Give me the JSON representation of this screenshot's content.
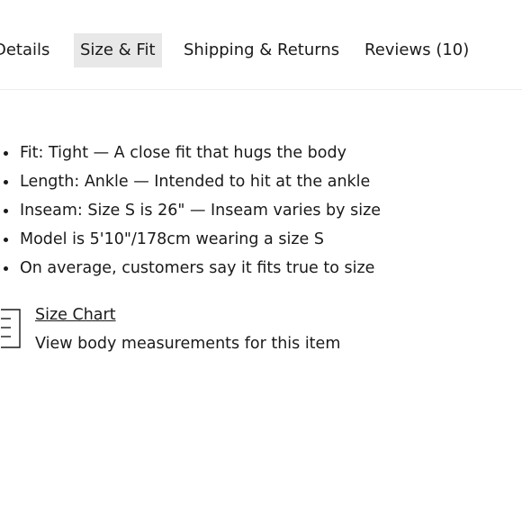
{
  "tabs": [
    {
      "label": "Details",
      "active": false
    },
    {
      "label": "Size & Fit",
      "active": true
    },
    {
      "label": "Shipping & Returns",
      "active": false
    },
    {
      "label": "Reviews (10)",
      "active": false
    }
  ],
  "fit_details": [
    "Fit: Tight — A close fit that hugs the body",
    "Length: Ankle — Intended to hit at the ankle",
    "Inseam: Size S is 26\" — Inseam varies by size",
    "Model is 5'10\"/178cm wearing a size S",
    "On average, customers say it fits true to size"
  ],
  "size_chart": {
    "link_label": "Size Chart",
    "description": "View body measurements for this item",
    "icon": "ruler-icon"
  }
}
